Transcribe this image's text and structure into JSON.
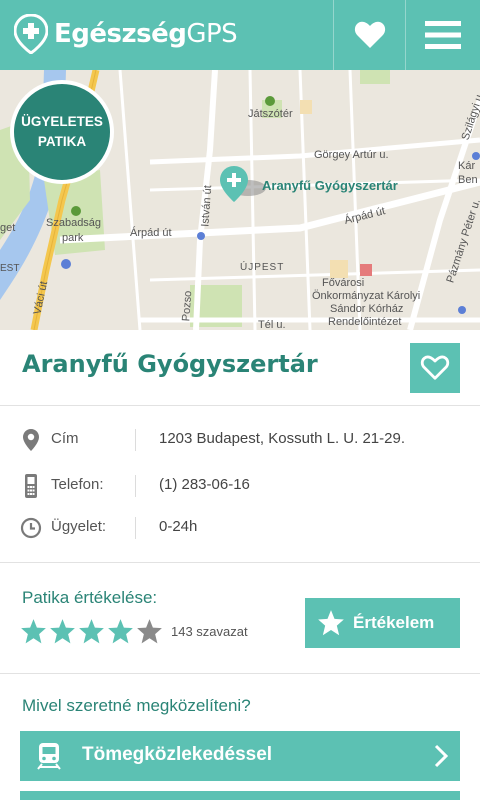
{
  "app": {
    "logo_bold": "Egészség",
    "logo_light": "GPS",
    "brand_color": "#5cc1b3",
    "accent_dark": "#2a8476"
  },
  "header": {
    "favorites_icon": "heart-icon",
    "menu_icon": "hamburger-menu-icon"
  },
  "map": {
    "badge_line1": "ÜGYELETES",
    "badge_line2": "PATIKA",
    "pin_label": "Aranyfű Gyógyszertár",
    "labels": {
      "jatszoter": "Játszótér",
      "gorgey": "Görgey Artúr u.",
      "szabadsag": "Szabadság",
      "park": "park",
      "arpad_left": "Árpád út",
      "arpad_right": "Árpád út",
      "ujpest": "ÚJPEST",
      "istvan": "István út",
      "vaci": "Váci út",
      "fovarosi1": "Fővárosi",
      "fovarosi2": "Önkormányzat Károlyi",
      "fovarosi3": "Sándor Kórház",
      "fovarosi4": "Rendelőintézet",
      "tel": "Tél u.",
      "pazmany": "Pázmány Péter u.",
      "szilagyi": "Szilágyi u.",
      "kara1": "Kár",
      "kara2": "Ben",
      "get": "get",
      "est": "EST",
      "pozso": "Pozso"
    }
  },
  "pharmacy": {
    "name": "Aranyfű Gyógyszertár",
    "favorite_icon": "heart-outline-icon"
  },
  "info": [
    {
      "icon": "location-pin-icon",
      "label": "Cím",
      "value": "1203 Budapest, Kossuth L. U. 21-29."
    },
    {
      "icon": "phone-icon",
      "label": "Telefon:",
      "value": "(1) 283-06-16"
    },
    {
      "icon": "clock-icon",
      "label": "Ügyelet:",
      "value": "0-24h"
    }
  ],
  "rating": {
    "label": "Patika értékelése:",
    "stars_filled": 4,
    "stars_total": 5,
    "votes": "143 szavazat",
    "button_label": "Értékelem"
  },
  "approach": {
    "question": "Mivel szeretné megközelíteni?",
    "options": [
      {
        "icon": "train-icon",
        "label": "Tömegközlekedéssel"
      }
    ]
  }
}
